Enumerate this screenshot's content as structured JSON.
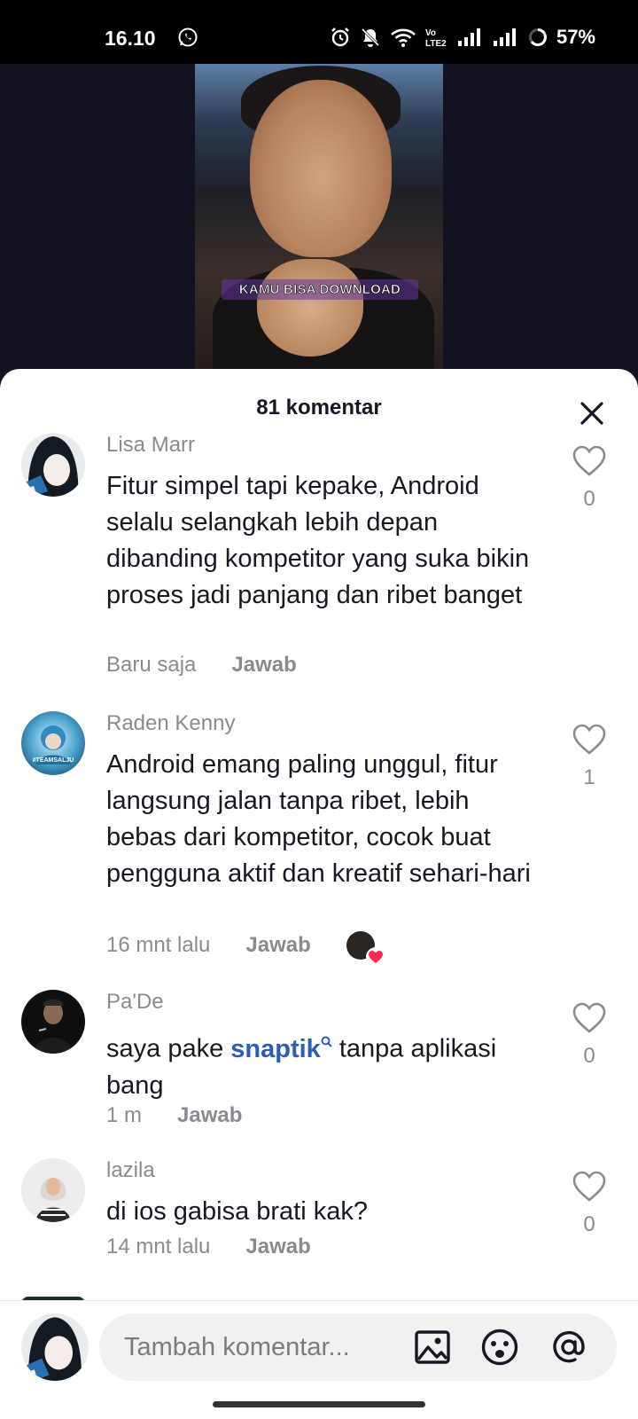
{
  "status_bar": {
    "time": "16.10",
    "battery": "57%",
    "icons": [
      "whatsapp-icon",
      "alarm-icon",
      "mute-icon",
      "wifi-icon",
      "volte-icon",
      "signal-icon",
      "signal-icon",
      "battery-icon"
    ]
  },
  "video": {
    "caption": "KAMU BISA DOWNLOAD"
  },
  "comments_sheet": {
    "title": "81 komentar",
    "close_icon": "close-icon",
    "comments": [
      {
        "username": "Lisa Marr",
        "text": "Fitur simpel tapi kepake, Android selalu selangkah lebih depan dibanding kompetitor yang suka bikin proses jadi panjang dan ribet banget",
        "time": "Baru saja",
        "reply": "Jawab",
        "likes": "0"
      },
      {
        "username": "Raden Kenny",
        "text": "Android emang paling unggul, fitur langsung jalan tanpa ribet, lebih bebas dari kompetitor, cocok buat pengguna aktif dan kreatif sehari-hari",
        "time": "16 mnt lalu",
        "reply": "Jawab",
        "likes": "1",
        "avatar_caption": "#TEAMSALJU"
      },
      {
        "username": "Pa'De",
        "text_before": "saya pake ",
        "text_link": "snaptik",
        "text_after": " tanpa aplikasi bang",
        "time": "1 m",
        "reply": "Jawab",
        "likes": "0"
      },
      {
        "username": "lazila",
        "text": "di ios gabisa brati kak?",
        "time": "14 mnt lalu",
        "reply": "Jawab",
        "likes": "0"
      }
    ]
  },
  "composer": {
    "placeholder": "Tambah komentar...",
    "icons": [
      "image-icon",
      "emoji-icon",
      "mention-icon"
    ]
  },
  "colors": {
    "link": "#2b5db9",
    "muted": "#8a8b91",
    "text": "#161823",
    "like_heart_red": "#fe2c55"
  }
}
